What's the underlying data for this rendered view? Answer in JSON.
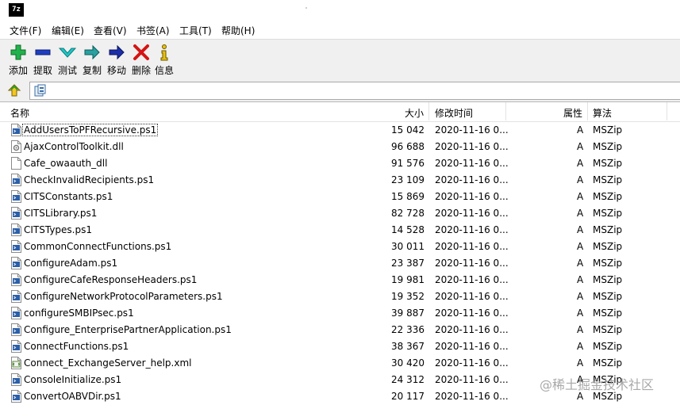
{
  "app": {
    "icon_text": "7z"
  },
  "menu": [
    {
      "label": "文件(F)"
    },
    {
      "label": "编辑(E)"
    },
    {
      "label": "查看(V)"
    },
    {
      "label": "书签(A)"
    },
    {
      "label": "工具(T)"
    },
    {
      "label": "帮助(H)"
    }
  ],
  "toolbar": {
    "add": "添加",
    "extract": "提取",
    "test": "测试",
    "copy": "复制",
    "move": "移动",
    "delete": "删除",
    "info": "信息"
  },
  "columns": {
    "name": "名称",
    "size": "大小",
    "modified": "修改时间",
    "attributes": "属性",
    "method": "算法"
  },
  "files": [
    {
      "name": "AddUsersToPFRecursive.ps1",
      "size": "15 042",
      "modified": "2020-11-16 0...",
      "attr": "A",
      "method": "MSZip",
      "icon": "script-icon"
    },
    {
      "name": "AjaxControlToolkit.dll",
      "size": "96 688",
      "modified": "2020-11-16 0...",
      "attr": "A",
      "method": "MSZip",
      "icon": "dll-icon"
    },
    {
      "name": "Cafe_owaauth_dll",
      "size": "91 576",
      "modified": "2020-11-16 0...",
      "attr": "A",
      "method": "MSZip",
      "icon": "blank-file-icon"
    },
    {
      "name": "CheckInvalidRecipients.ps1",
      "size": "23 109",
      "modified": "2020-11-16 0...",
      "attr": "A",
      "method": "MSZip",
      "icon": "script-icon"
    },
    {
      "name": "CITSConstants.ps1",
      "size": "15 869",
      "modified": "2020-11-16 0...",
      "attr": "A",
      "method": "MSZip",
      "icon": "script-icon"
    },
    {
      "name": "CITSLibrary.ps1",
      "size": "82 728",
      "modified": "2020-11-16 0...",
      "attr": "A",
      "method": "MSZip",
      "icon": "script-icon"
    },
    {
      "name": "CITSTypes.ps1",
      "size": "14 528",
      "modified": "2020-11-16 0...",
      "attr": "A",
      "method": "MSZip",
      "icon": "script-icon"
    },
    {
      "name": "CommonConnectFunctions.ps1",
      "size": "30 011",
      "modified": "2020-11-16 0...",
      "attr": "A",
      "method": "MSZip",
      "icon": "script-icon"
    },
    {
      "name": "ConfigureAdam.ps1",
      "size": "23 387",
      "modified": "2020-11-16 0...",
      "attr": "A",
      "method": "MSZip",
      "icon": "script-icon"
    },
    {
      "name": "ConfigureCafeResponseHeaders.ps1",
      "size": "19 981",
      "modified": "2020-11-16 0...",
      "attr": "A",
      "method": "MSZip",
      "icon": "script-icon"
    },
    {
      "name": "ConfigureNetworkProtocolParameters.ps1",
      "size": "19 352",
      "modified": "2020-11-16 0...",
      "attr": "A",
      "method": "MSZip",
      "icon": "script-icon"
    },
    {
      "name": "configureSMBIPsec.ps1",
      "size": "39 887",
      "modified": "2020-11-16 0...",
      "attr": "A",
      "method": "MSZip",
      "icon": "script-icon"
    },
    {
      "name": "Configure_EnterprisePartnerApplication.ps1",
      "size": "22 336",
      "modified": "2020-11-16 0...",
      "attr": "A",
      "method": "MSZip",
      "icon": "script-icon"
    },
    {
      "name": "ConnectFunctions.ps1",
      "size": "38 367",
      "modified": "2020-11-16 0...",
      "attr": "A",
      "method": "MSZip",
      "icon": "script-icon"
    },
    {
      "name": "Connect_ExchangeServer_help.xml",
      "size": "30 420",
      "modified": "2020-11-16 0...",
      "attr": "A",
      "method": "MSZip",
      "icon": "xml-icon"
    },
    {
      "name": "ConsoleInitialize.ps1",
      "size": "24 312",
      "modified": "2020-11-16 0...",
      "attr": "A",
      "method": "MSZip",
      "icon": "script-icon"
    },
    {
      "name": "ConvertOABVDir.ps1",
      "size": "20 117",
      "modified": "2020-11-16 0...",
      "attr": "A",
      "method": "MSZip",
      "icon": "script-icon"
    }
  ],
  "watermark": "@稀土掘金技术社区"
}
